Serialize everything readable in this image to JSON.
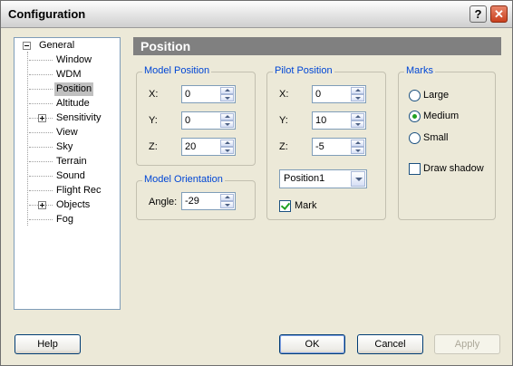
{
  "window": {
    "title": "Configuration"
  },
  "titlebar": {
    "help_glyph": "?",
    "close_glyph": "✕"
  },
  "tree": {
    "root_label": "General",
    "items": [
      {
        "label": "Window"
      },
      {
        "label": "WDM"
      },
      {
        "label": "Position",
        "selected": true
      },
      {
        "label": "Altitude"
      },
      {
        "label": "Sensitivity",
        "expandable": true
      },
      {
        "label": "View"
      },
      {
        "label": "Sky"
      },
      {
        "label": "Terrain"
      },
      {
        "label": "Sound"
      },
      {
        "label": "Flight Rec"
      },
      {
        "label": "Objects",
        "expandable": true
      },
      {
        "label": "Fog"
      }
    ]
  },
  "panel": {
    "title": "Position"
  },
  "model_position": {
    "title": "Model Position",
    "x": {
      "label": "X:",
      "value": "0"
    },
    "y": {
      "label": "Y:",
      "value": "0"
    },
    "z": {
      "label": "Z:",
      "value": "20"
    }
  },
  "model_orientation": {
    "title": "Model Orientation",
    "angle": {
      "label": "Angle:",
      "value": "-29"
    }
  },
  "pilot_position": {
    "title": "Pilot Position",
    "x": {
      "label": "X:",
      "value": "0"
    },
    "y": {
      "label": "Y:",
      "value": "10"
    },
    "z": {
      "label": "Z:",
      "value": "-5"
    },
    "preset": "Position1",
    "mark_label": "Mark",
    "mark_checked": true
  },
  "marks": {
    "title": "Marks",
    "options": [
      "Large",
      "Medium",
      "Small"
    ],
    "selected": "Medium",
    "shadow_label": "Draw shadow",
    "shadow_checked": false
  },
  "buttons": {
    "help": "Help",
    "ok": "OK",
    "cancel": "Cancel",
    "apply": "Apply"
  },
  "colors": {
    "group_title": "#0046d5",
    "header_bg": "#808080",
    "dialog_bg": "#ece9d8"
  }
}
